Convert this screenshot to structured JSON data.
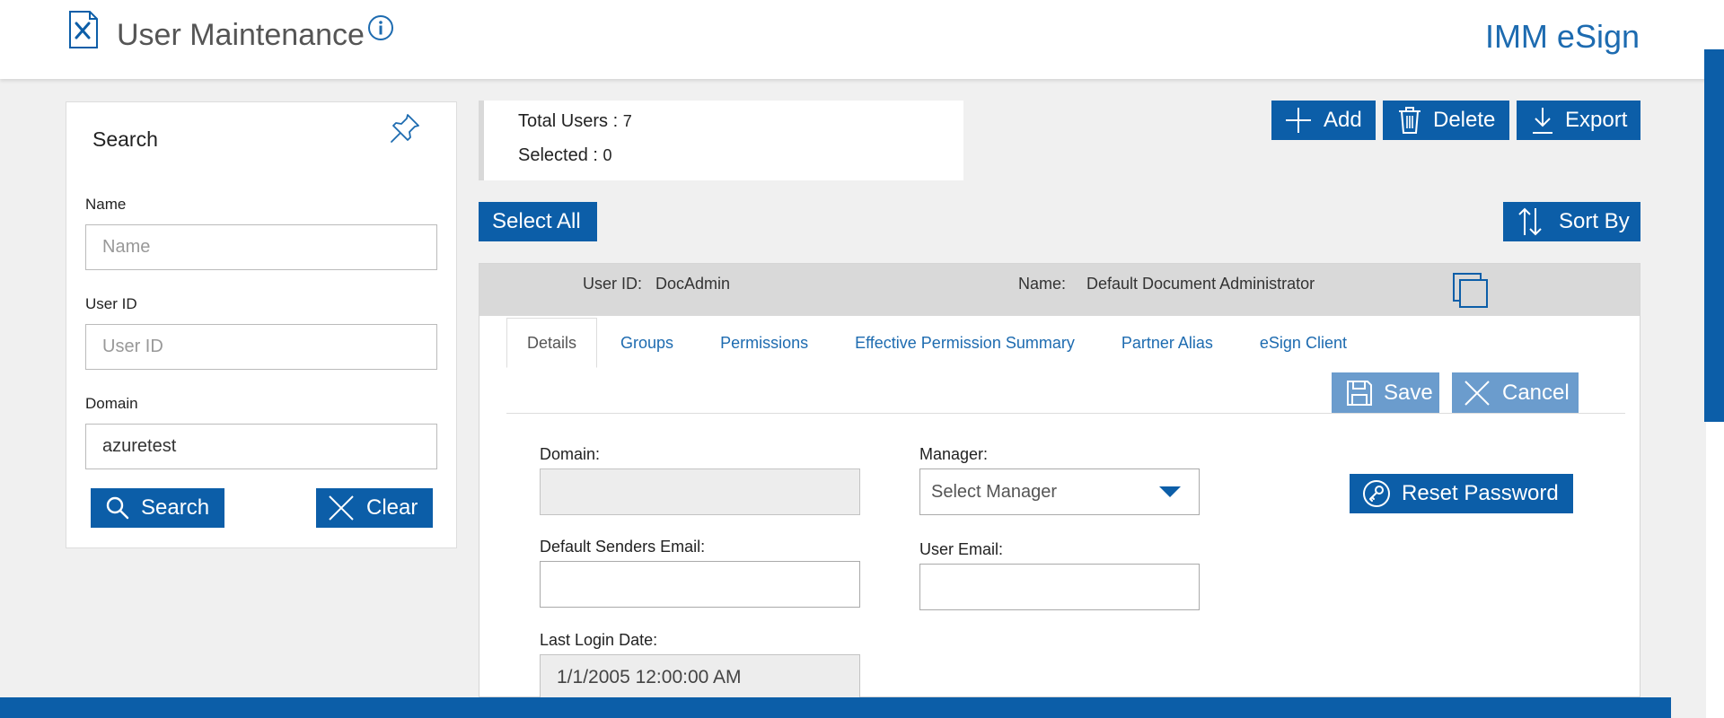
{
  "header": {
    "title": "User Maintenance",
    "brand": "IMM eSign",
    "icons": {
      "app": "tools-document-icon",
      "info": "info-icon"
    }
  },
  "search_panel": {
    "heading": "Search",
    "name_label": "Name",
    "name_placeholder": "Name",
    "name_value": "",
    "userid_label": "User ID",
    "userid_placeholder": "User ID",
    "userid_value": "",
    "domain_label": "Domain",
    "domain_value": "azuretest",
    "search_button": "Search",
    "clear_button": "Clear"
  },
  "summary": {
    "total_label": "Total Users :",
    "total_value": "7",
    "selected_label": "Selected :",
    "selected_value": "0"
  },
  "toolbar": {
    "add": "Add",
    "delete": "Delete",
    "export": "Export",
    "select_all": "Select All",
    "sort_by": "Sort By"
  },
  "user_record": {
    "userid_label": "User ID:",
    "userid_value": "DocAdmin",
    "name_label": "Name:",
    "name_value": "Default Document Administrator"
  },
  "tabs": [
    {
      "label": "Details",
      "active": true
    },
    {
      "label": "Groups"
    },
    {
      "label": "Permissions"
    },
    {
      "label": "Effective Permission Summary"
    },
    {
      "label": "Partner Alias"
    },
    {
      "label": "eSign Client"
    }
  ],
  "details": {
    "save": "Save",
    "cancel": "Cancel",
    "domain_label": "Domain:",
    "domain_value": "",
    "manager_label": "Manager:",
    "manager_value": "Select Manager",
    "reset_password": "Reset Password",
    "senders_email_label": "Default Senders Email:",
    "senders_email_value": "",
    "user_email_label": "User Email:",
    "user_email_value": "",
    "last_login_label": "Last Login Date:",
    "last_login_value": "1/1/2005 12:00:00 AM"
  },
  "colors": {
    "primary": "#0c5ea8",
    "link": "#1d6bb0",
    "disabled_button": "#6b9ccd",
    "background": "#f0f0f0"
  }
}
